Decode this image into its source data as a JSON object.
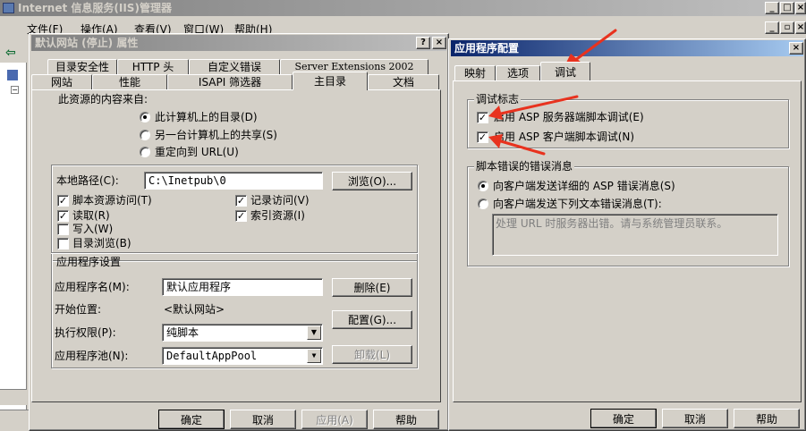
{
  "main_window": {
    "title": "Internet 信息服务(IIS)管理器",
    "menu": [
      "文件(F)",
      "操作(A)",
      "查看(V)",
      "窗口(W)",
      "帮助(H)"
    ]
  },
  "properties_dialog": {
    "title": "默认网站 (停止) 属性",
    "tabs_row1": [
      "目录安全性",
      "HTTP 头",
      "自定义错误",
      "Server Extensions 2002"
    ],
    "tabs_row2": [
      "网站",
      "性能",
      "ISAPI 筛选器",
      "主目录",
      "文档"
    ],
    "content_source_label": "此资源的内容来自:",
    "source_options": [
      "此计算机上的目录(D)",
      "另一台计算机上的共享(S)",
      "重定向到 URL(U)"
    ],
    "local_path_label": "本地路径(C):",
    "local_path_value": "C:\\Inetpub\\0",
    "browse_button": "浏览(O)...",
    "checkboxes_left": [
      {
        "label": "脚本资源访问(T)",
        "checked": true
      },
      {
        "label": "读取(R)",
        "checked": true
      },
      {
        "label": "写入(W)",
        "checked": false
      },
      {
        "label": "目录浏览(B)",
        "checked": false
      }
    ],
    "checkboxes_right": [
      {
        "label": "记录访问(V)",
        "checked": true
      },
      {
        "label": "索引资源(I)",
        "checked": true
      }
    ],
    "app_settings_label": "应用程序设置",
    "app_name_label": "应用程序名(M):",
    "app_name_value": "默认应用程序",
    "remove_button": "删除(E)",
    "start_point_label": "开始位置:",
    "start_point_value": "<默认网站>",
    "config_button": "配置(G)...",
    "exec_perm_label": "执行权限(P):",
    "exec_perm_value": "纯脚本",
    "app_pool_label": "应用程序池(N):",
    "app_pool_value": "DefaultAppPool",
    "unload_button": "卸载(L)",
    "ok_button": "确定",
    "cancel_button": "取消",
    "apply_button": "应用(A)",
    "help_button": "帮助"
  },
  "app_config_dialog": {
    "title": "应用程序配置",
    "tabs": [
      "映射",
      "选项",
      "调试"
    ],
    "debug_flags_label": "调试标志",
    "debug_server": "启用 ASP 服务器端脚本调试(E)",
    "debug_client": "启用 ASP 客户端脚本调试(N)",
    "script_error_label": "脚本错误的错误消息",
    "error_option_detailed": "向客户端发送详细的 ASP 错误消息(S)",
    "error_option_text": "向客户端发送下列文本错误消息(T):",
    "error_text_value": "处理 URL 时服务器出错。请与系统管理员联系。",
    "ok_button": "确定",
    "cancel_button": "取消",
    "help_button": "帮助"
  },
  "colors": {
    "face": "#d4d0c8",
    "active_title": "#0a246a",
    "arrow_red": "#e8321e"
  }
}
